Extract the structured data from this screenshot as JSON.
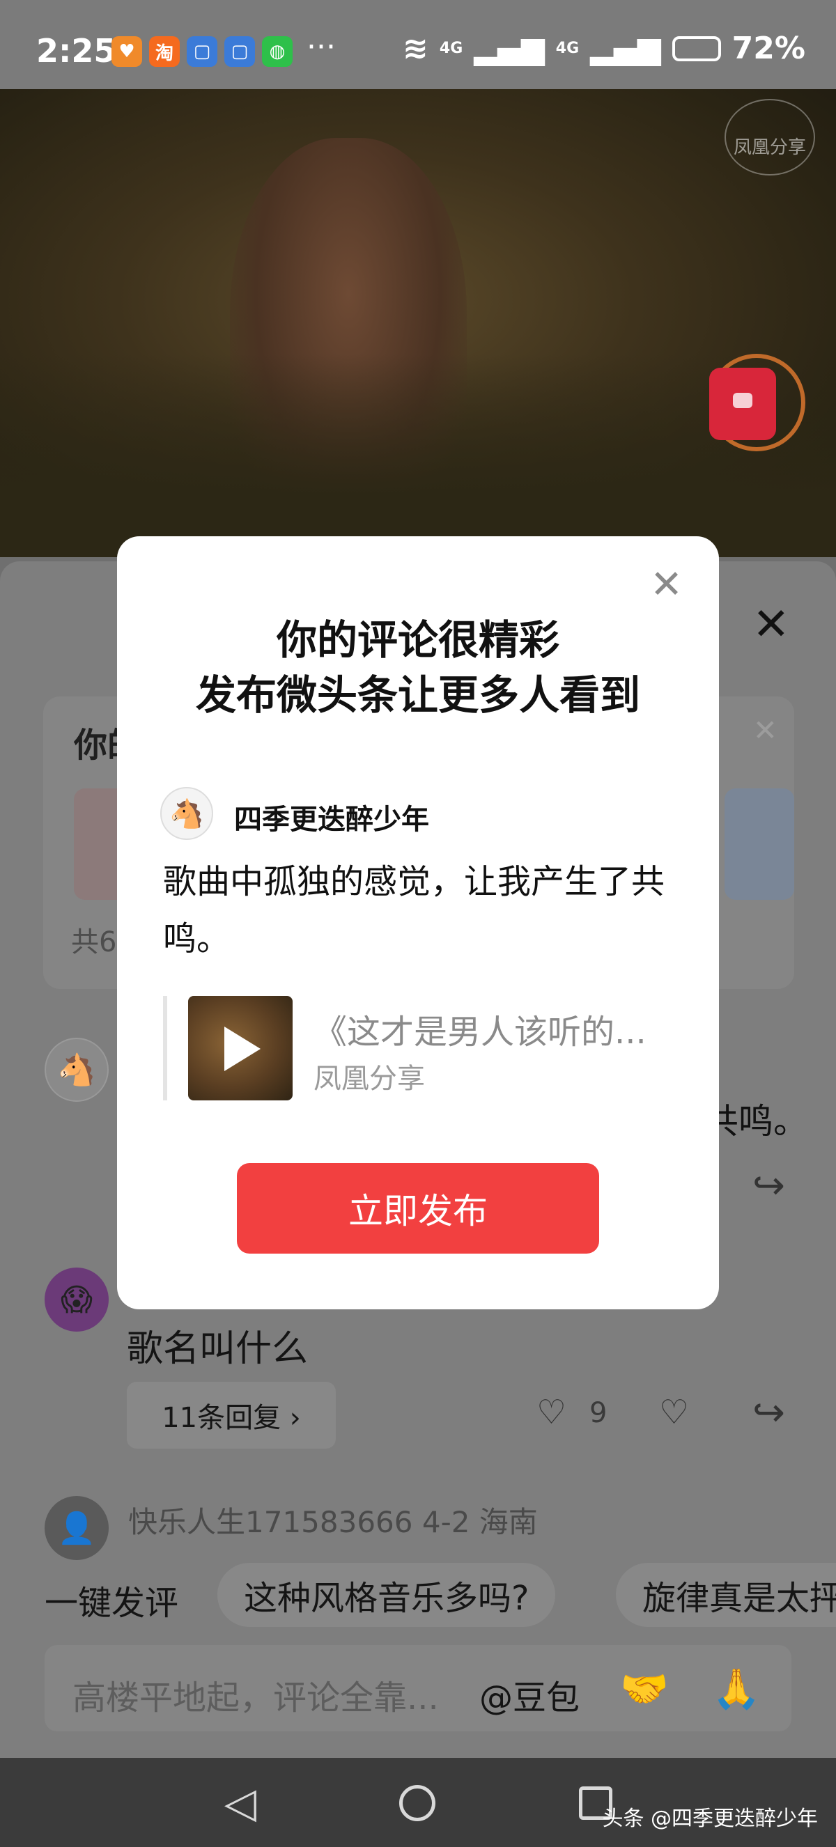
{
  "status_bar": {
    "time": "2:25",
    "more": "···",
    "signal_1": "4G",
    "signal_2": "4G",
    "battery": "72%",
    "app_icons": [
      {
        "name": "heart-app-icon",
        "color": "#f08a2a",
        "glyph": "♥"
      },
      {
        "name": "taobao-icon",
        "color": "#f56a1e",
        "glyph": "淘"
      },
      {
        "name": "blue-app-icon",
        "color": "#3b7bd8",
        "glyph": "▢"
      },
      {
        "name": "blue-app-icon-2",
        "color": "#3b7bd8",
        "glyph": "▢"
      },
      {
        "name": "wechat-icon",
        "color": "#2ec04a",
        "glyph": "◍"
      }
    ]
  },
  "video": {
    "watermark": "凤凰分享"
  },
  "background_sheet": {
    "card_title": "你的",
    "card_count": "共6",
    "comment_tail": "共鸣。",
    "comment_text": "歌名叫什么",
    "replies_label": "11条回复 ›",
    "like_count": "9",
    "next_user": "快乐人生171583666  4-2  海南",
    "quick_label": "一键发评",
    "quick_chips": [
      "这种风格音乐多吗?",
      "旋律真是太抨"
    ],
    "input_placeholder": "高楼平地起，评论全靠...",
    "input_at": "@豆包",
    "emoji_1": "🤝",
    "emoji_2": "🙏"
  },
  "modal": {
    "title_line_1": "你的评论很精彩",
    "title_line_2": "发布微头条让更多人看到",
    "username": "四季更迭醉少年",
    "comment": "歌曲中孤独的感觉，让我产生了共鸣。",
    "quote_title": "《这才是男人该听的...",
    "quote_source": "凤凰分享",
    "publish_button": "立即发布"
  },
  "watermark_footer": "头条 @四季更迭醉少年",
  "colors": {
    "accent_red": "#f24040",
    "overlay_gray": "#7e7e7e"
  }
}
